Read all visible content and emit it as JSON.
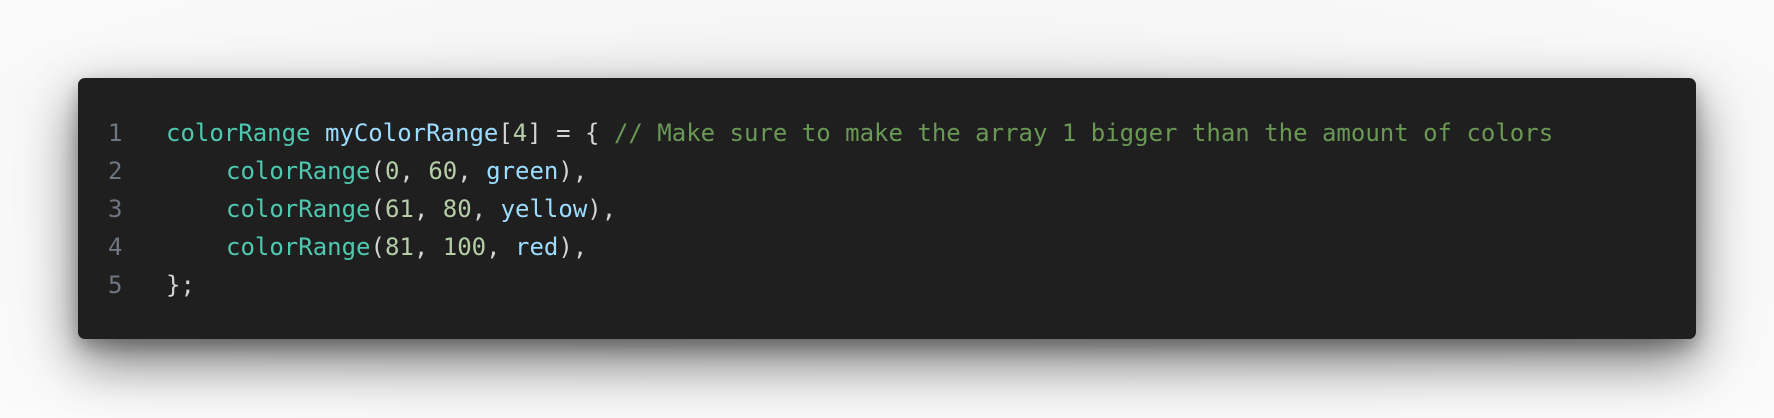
{
  "theme": {
    "background": "#1f1f1f",
    "line_number_color": "#6e7681",
    "type_color": "#4ec9b0",
    "variable_color": "#9cdcfe",
    "number_color": "#b5cea8",
    "punctuation_color": "#d4d4d4",
    "comment_color": "#6a9955"
  },
  "code": {
    "language": "C++",
    "lines": [
      {
        "number": "1",
        "tokens": {
          "t1": "colorRange",
          "t2": " ",
          "t3": "myColorRange",
          "t4": "[",
          "t5": "4",
          "t6": "] = { ",
          "t7": "// Make sure to make the array 1 bigger than the amount of colors"
        }
      },
      {
        "number": "2",
        "tokens": {
          "t1": "colorRange",
          "t2": "(",
          "t3": "0",
          "t4": ", ",
          "t5": "60",
          "t6": ", ",
          "t7": "green",
          "t8": "),"
        }
      },
      {
        "number": "3",
        "tokens": {
          "t1": "colorRange",
          "t2": "(",
          "t3": "61",
          "t4": ", ",
          "t5": "80",
          "t6": ", ",
          "t7": "yellow",
          "t8": "),"
        }
      },
      {
        "number": "4",
        "tokens": {
          "t1": "colorRange",
          "t2": "(",
          "t3": "81",
          "t4": ", ",
          "t5": "100",
          "t6": ", ",
          "t7": "red",
          "t8": "),"
        }
      },
      {
        "number": "5",
        "tokens": {
          "t1": "};"
        }
      }
    ]
  }
}
